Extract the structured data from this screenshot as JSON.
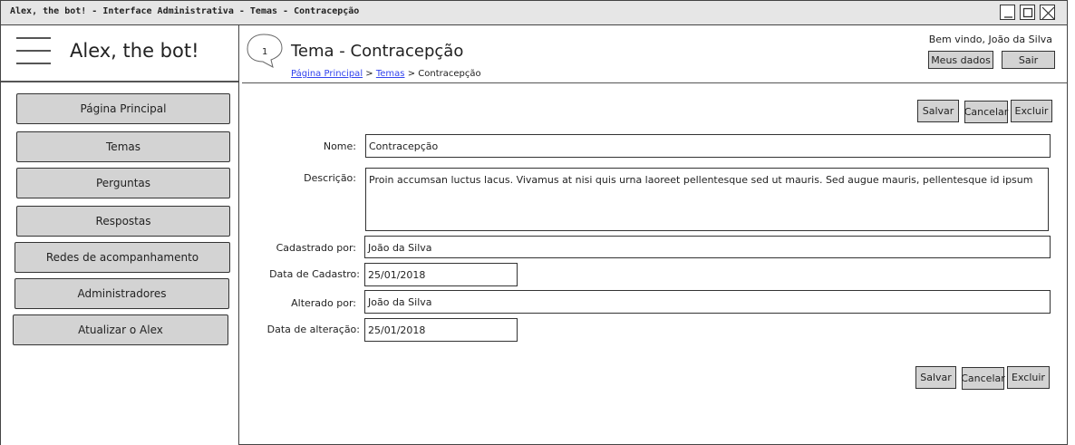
{
  "window": {
    "title": "Alex, the bot! - Interface Administrativa - Temas - Contracepção"
  },
  "sidebar": {
    "brand": "Alex, the bot!",
    "items": [
      {
        "label": "Página Principal"
      },
      {
        "label": "Temas"
      },
      {
        "label": "Perguntas"
      },
      {
        "label": "Respostas"
      },
      {
        "label": "Redes de acompanhamento"
      },
      {
        "label": "Administradores"
      },
      {
        "label": "Atualizar o Alex"
      }
    ]
  },
  "header": {
    "step": "1",
    "title": "Tema - Contracepção",
    "breadcrumb": {
      "home": "Página Principal",
      "sep": ">",
      "section": "Temas",
      "current": "Contracepção"
    },
    "welcome": "Bem vindo, João da Silva",
    "my_data": "Meus dados",
    "logout": "Sair"
  },
  "actions": {
    "save": "Salvar",
    "cancel": "Cancelar",
    "delete": "Excluir"
  },
  "form": {
    "name_label": "Nome:",
    "name_value": "Contracepção",
    "description_label": "Descrição:",
    "description_value": "Proin accumsan luctus lacus. Vivamus at nisi quis urna laoreet pellentesque sed ut mauris. Sed augue mauris, pellentesque id ipsum",
    "created_by_label": "Cadastrado por:",
    "created_by_value": "João da Silva",
    "created_date_label": "Data de Cadastro:",
    "created_date_value": "25/01/2018",
    "updated_by_label": "Alterado por:",
    "updated_by_value": "João da Silva",
    "updated_date_label": "Data de alteração:",
    "updated_date_value": "25/01/2018"
  }
}
